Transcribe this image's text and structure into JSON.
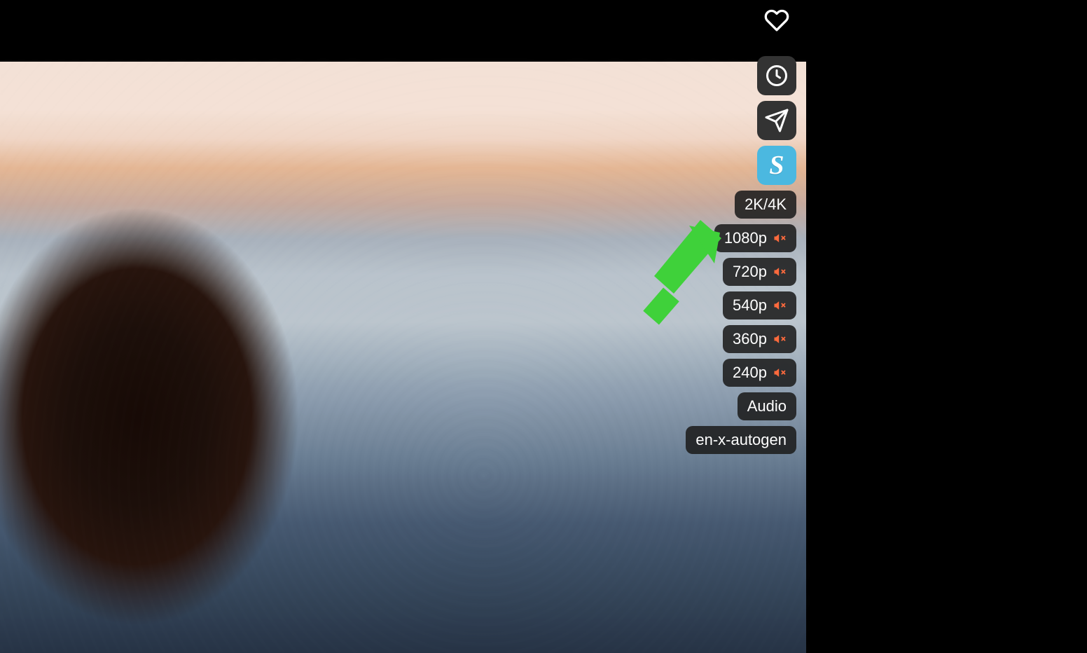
{
  "video_area": {
    "visible": true
  },
  "favorite": {
    "active": false
  },
  "side_icons": {
    "clock": "clock-icon",
    "send": "paper-plane-icon",
    "s": "S"
  },
  "quality_options": [
    {
      "label": "2K/4K",
      "muted": false
    },
    {
      "label": "1080p",
      "muted": true
    },
    {
      "label": "720p",
      "muted": true
    },
    {
      "label": "540p",
      "muted": true
    },
    {
      "label": "360p",
      "muted": true
    },
    {
      "label": "240p",
      "muted": true
    },
    {
      "label": "Audio",
      "muted": false
    }
  ],
  "subtitle_option": "en-x-autogen",
  "annotation_arrow_color": "#3fd13a"
}
